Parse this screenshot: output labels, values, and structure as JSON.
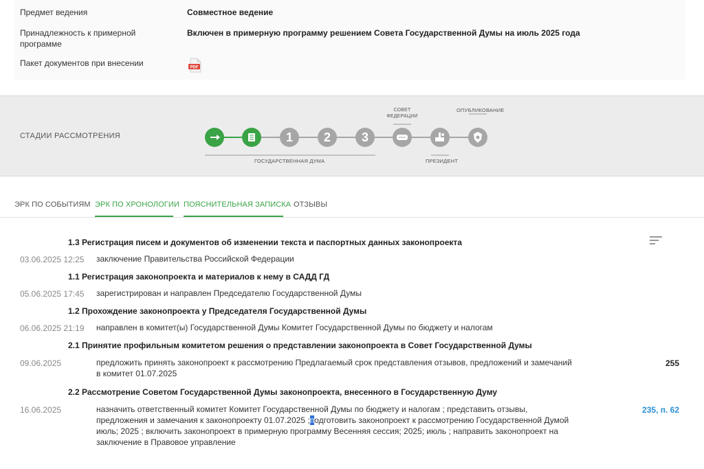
{
  "info": {
    "rows": [
      {
        "label": "Предмет ведения",
        "value": "Совместное ведение"
      },
      {
        "label": "Принадлежность к примерной программе",
        "value": "Включен в примерную программу решением Совета Государственной Думы на июль 2025 года"
      },
      {
        "label": "Пакет документов при внесении",
        "value": ""
      }
    ],
    "pdf_label": "PDF"
  },
  "stages": {
    "title": "СТАДИИ РАССМОТРЕНИЯ",
    "label_gd": "ГОСУДАРСТВЕННАЯ ДУМА",
    "label_sf": "СОВЕТ ФЕДЕРАЦИИ",
    "label_pres": "ПРЕЗИДЕНТ",
    "label_pub": "ОПУБЛИКОВАНИЕ",
    "steps": [
      {
        "icon": "arrow-icon",
        "state": "done"
      },
      {
        "icon": "document-icon",
        "state": "done"
      },
      {
        "icon": "reading-1",
        "text": "1",
        "state": "pending"
      },
      {
        "icon": "reading-2",
        "text": "2",
        "state": "pending"
      },
      {
        "icon": "reading-3",
        "text": "3",
        "state": "pending"
      },
      {
        "icon": "federation-council-icon",
        "state": "pending"
      },
      {
        "icon": "president-icon",
        "state": "pending"
      },
      {
        "icon": "emblem-icon",
        "state": "pending"
      }
    ],
    "colors": {
      "done": "#3aa346",
      "pending": "#a6a6a6"
    }
  },
  "tabs": [
    {
      "label": "ЭРК ПО СОБЫТИЯМ",
      "active": false
    },
    {
      "label": "ЭРК ПО ХРОНОЛОГИИ",
      "active": true
    },
    {
      "label": "ПОЯСНИТЕЛЬНАЯ ЗАПИСКА",
      "active": true
    },
    {
      "label": "ОТЗЫВЫ",
      "active": false
    }
  ],
  "events": {
    "h1": "1.3 Регистрация писем и документов об изменении текста и паспортных данных законопроекта",
    "e1_date": "03.06.2025 12:25",
    "e1_text": "заключение Правительства Российской Федерации",
    "h2": "1.1 Регистрация законопроекта и материалов к нему в САДД ГД",
    "e2_date": "05.06.2025 17:45",
    "e2_text": "зарегистрирован и направлен Председателю Государственной Думы",
    "h3": "1.2 Прохождение законопроекта у Председателя Государственной Думы",
    "e3_date": "06.06.2025 21:19",
    "e3_text": "направлен в комитет(ы) Государственной Думы Комитет Государственной Думы по бюджету и налогам",
    "h4": "2.1 Принятие профильным комитетом решения о представлении законопроекта в Совет Государственной Думы",
    "e4_date": "09.06.2025",
    "e4_line1": "предложить принять законопроект к рассмотрению Предлагаемый срок представления отзывов, предложений и замечаний",
    "e4_line2": "в комитет 01.07.2025",
    "e4_num": "255",
    "h5": "2.2 Рассмотрение Советом Государственной Думы законопроекта, внесенного в Государственную Думу",
    "e5_date": "16.06.2025",
    "e5_line1": "назначить ответственный комитет Комитет Государственной Думы по бюджету и налогам ; представить отзывы,",
    "e5_line2a": "предложения и замечания к законопроекту 01.07.2025 ;",
    "e5_line2sel": "п",
    "e5_line2b": "одготовить законопроект к рассмотрению Государственной Думой",
    "e5_line3": "июль; 2025 ; включить законопроект в примерную программу Весенняя сессия; 2025; июль ; направить законопроект на",
    "e5_line4": "заключение в Правовое управление",
    "e5_num": "235, п. 62"
  }
}
